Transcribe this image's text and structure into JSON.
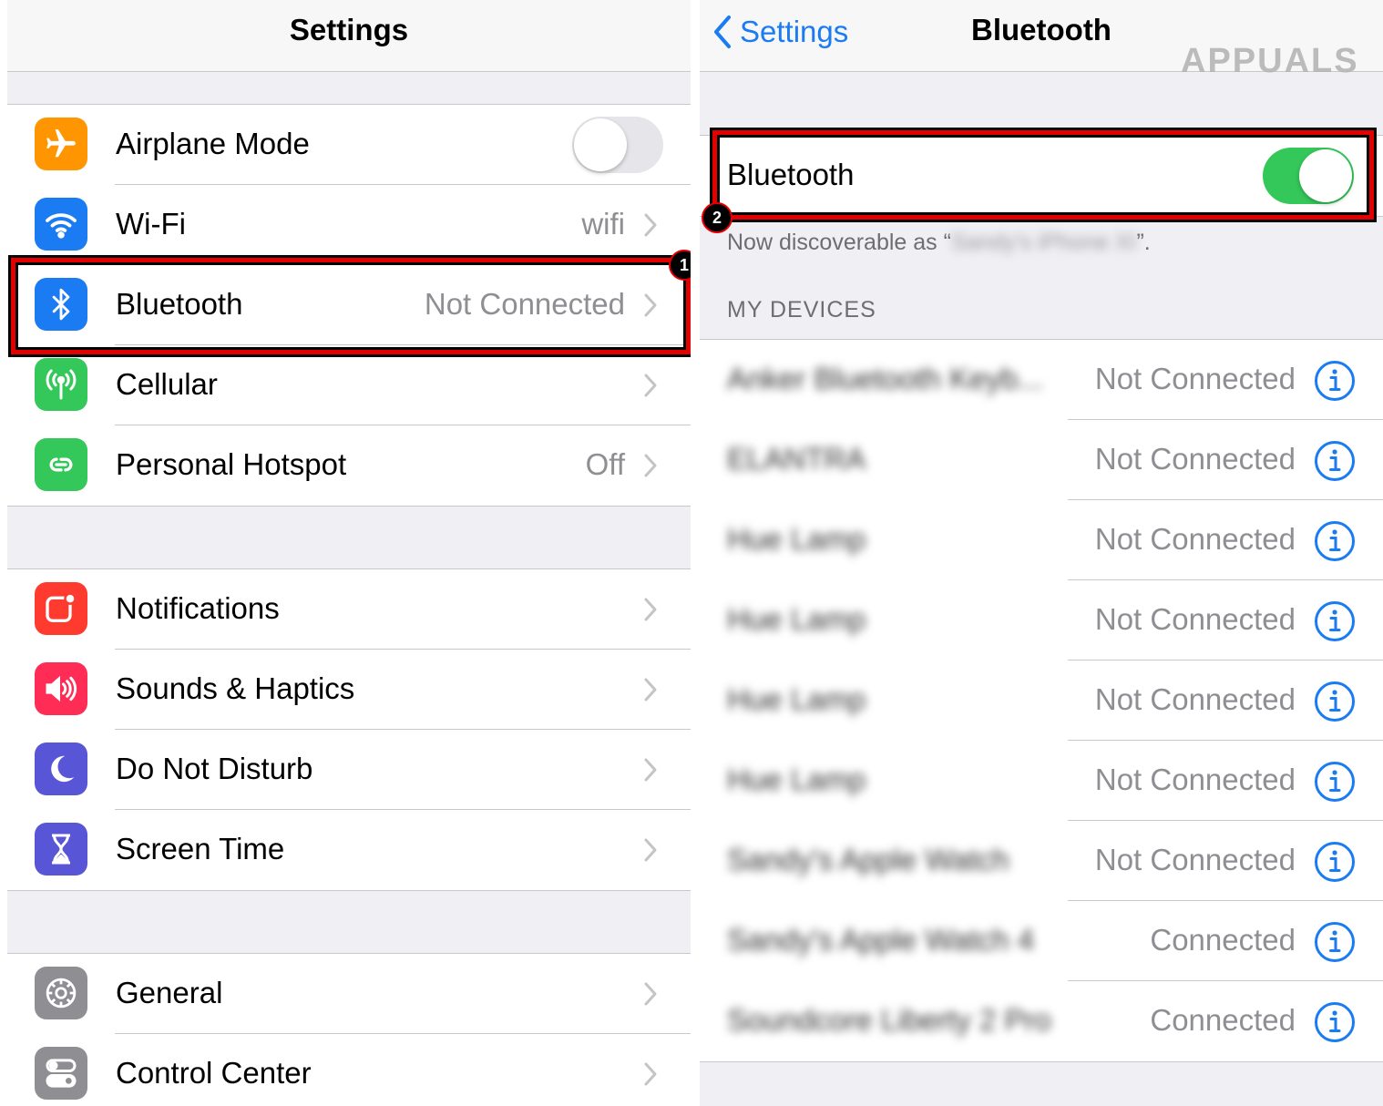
{
  "left_panel": {
    "title": "Settings",
    "group1": [
      {
        "label": "Airplane Mode",
        "icon": "airplane-icon",
        "color": "#ff9500",
        "toggle": "off"
      },
      {
        "label": "Wi-Fi",
        "icon": "wifi-icon",
        "color": "#1a7bf2",
        "value": "wifi"
      },
      {
        "label": "Bluetooth",
        "icon": "bluetooth-icon",
        "color": "#1a7bf2",
        "value": "Not Connected"
      },
      {
        "label": "Cellular",
        "icon": "cellular-icon",
        "color": "#34c759",
        "value": ""
      },
      {
        "label": "Personal Hotspot",
        "icon": "hotspot-icon",
        "color": "#34c759",
        "value": "Off"
      }
    ],
    "group2": [
      {
        "label": "Notifications",
        "icon": "notifications-icon",
        "color": "#ff3b30"
      },
      {
        "label": "Sounds & Haptics",
        "icon": "speaker-icon",
        "color": "#ff2d55"
      },
      {
        "label": "Do Not Disturb",
        "icon": "moon-icon",
        "color": "#5856d6"
      },
      {
        "label": "Screen Time",
        "icon": "hourglass-icon",
        "color": "#5856d6"
      }
    ],
    "group3": [
      {
        "label": "General",
        "icon": "gear-icon",
        "color": "#8e8e93"
      },
      {
        "label": "Control Center",
        "icon": "control-center-icon",
        "color": "#8e8e93"
      }
    ],
    "step_badge": "1"
  },
  "right_panel": {
    "back_label": "Settings",
    "title": "Bluetooth",
    "watermark": "APPUALS",
    "bluetooth_row_label": "Bluetooth",
    "bluetooth_toggle": "on",
    "discoverable_prefix": "Now discoverable as “",
    "discoverable_name": "Sandy's iPhone XI",
    "discoverable_suffix": "”.",
    "section_header": "MY DEVICES",
    "devices": [
      {
        "name": "Anker Bluetooth Keyb...",
        "status": "Not Connected"
      },
      {
        "name": "ELANTRA",
        "status": "Not Connected"
      },
      {
        "name": "Hue Lamp",
        "status": "Not Connected"
      },
      {
        "name": "Hue Lamp",
        "status": "Not Connected"
      },
      {
        "name": "Hue Lamp",
        "status": "Not Connected"
      },
      {
        "name": "Hue Lamp",
        "status": "Not Connected"
      },
      {
        "name": "Sandy's Apple Watch",
        "status": "Not Connected"
      },
      {
        "name": "Sandy's Apple Watch 4",
        "status": "Connected"
      },
      {
        "name": "Soundcore Liberty 2 Pro",
        "status": "Connected"
      }
    ],
    "step_badge": "2"
  },
  "colors": {
    "ios_blue": "#1a7bf2",
    "toggle_on": "#34c759",
    "highlight_red": "#e30000"
  }
}
